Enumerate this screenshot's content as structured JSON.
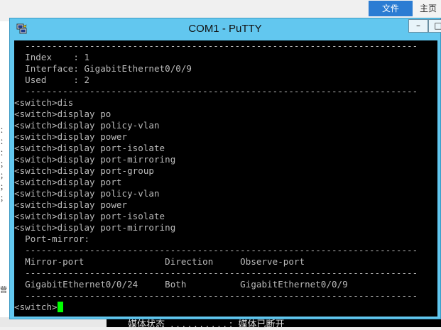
{
  "background": {
    "ribbon_tabs": [
      "文件",
      "主页"
    ],
    "left_marks": [
      "：",
      "：",
      "：",
      "；",
      "；",
      "；",
      "；",
      "营"
    ],
    "bottom_text": "媒体状态  . . . . . . . . . . :  媒体已断开"
  },
  "window": {
    "title": "COM1 - PuTTY",
    "min_label": "–",
    "max_label": "□",
    "accent": "#62c7ef"
  },
  "terminal": {
    "lines": [
      "  -------------------------------------------------------------------------",
      "  Index    : 1",
      "  Interface: GigabitEthernet0/0/9",
      "  Used     : 2",
      "  -------------------------------------------------------------------------",
      "<switch>dis",
      "<switch>display po",
      "<switch>display policy-vlan",
      "<switch>display power",
      "<switch>display port-isolate",
      "<switch>display port-mirroring",
      "<switch>display port-group",
      "<switch>display port",
      "<switch>display policy-vlan",
      "<switch>display power",
      "<switch>display port-isolate",
      "<switch>display port-mirroring",
      "  Port-mirror:",
      "  -------------------------------------------------------------------------",
      "  Mirror-port               Direction     Observe-port",
      "  -------------------------------------------------------------------------",
      "  GigabitEthernet0/0/24     Both          GigabitEthernet0/0/9",
      "  -------------------------------------------------------------------------"
    ],
    "prompt": "<switch>",
    "cursor_color": "#00ff00"
  }
}
